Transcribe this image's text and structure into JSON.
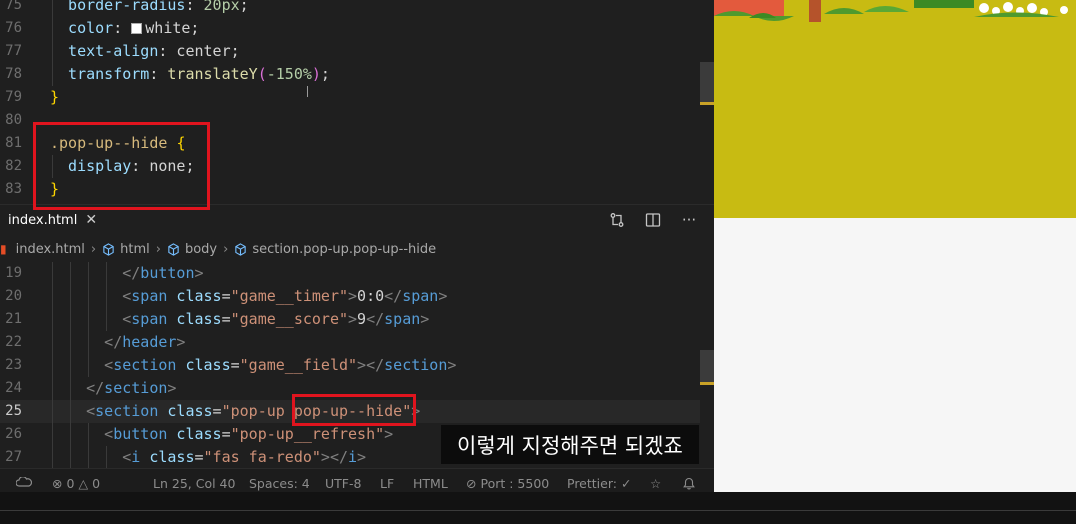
{
  "css_lines": [
    {
      "n": "75",
      "indent": 1,
      "tokens": [
        {
          "c": "prop",
          "t": "border-radius"
        },
        {
          "c": "punc",
          "t": ": "
        },
        {
          "c": "num",
          "t": "20px"
        },
        {
          "c": "punc",
          "t": ";"
        }
      ]
    },
    {
      "n": "76",
      "indent": 1,
      "tokens": [
        {
          "c": "prop",
          "t": "color"
        },
        {
          "c": "punc",
          "t": ": "
        },
        {
          "c": "swatch",
          "t": ""
        },
        {
          "c": "val",
          "t": "white"
        },
        {
          "c": "punc",
          "t": ";"
        }
      ]
    },
    {
      "n": "77",
      "indent": 1,
      "tokens": [
        {
          "c": "prop",
          "t": "text-align"
        },
        {
          "c": "punc",
          "t": ": "
        },
        {
          "c": "val",
          "t": "center"
        },
        {
          "c": "punc",
          "t": ";"
        }
      ]
    },
    {
      "n": "78",
      "indent": 1,
      "tokens": [
        {
          "c": "prop",
          "t": "transform"
        },
        {
          "c": "punc",
          "t": ": "
        },
        {
          "c": "fn",
          "t": "translateY"
        },
        {
          "c": "paren",
          "t": "("
        },
        {
          "c": "num",
          "t": "-150%"
        },
        {
          "c": "paren",
          "t": ")"
        },
        {
          "c": "punc",
          "t": ";"
        }
      ]
    },
    {
      "n": "79",
      "indent": 0,
      "tokens": [
        {
          "c": "brace",
          "t": "}"
        }
      ]
    },
    {
      "n": "80",
      "indent": 0,
      "tokens": []
    },
    {
      "n": "81",
      "indent": 0,
      "tokens": [
        {
          "c": "sel",
          "t": ".pop-up--hide"
        },
        {
          "c": "punc",
          "t": " "
        },
        {
          "c": "brace",
          "t": "{"
        }
      ]
    },
    {
      "n": "82",
      "indent": 1,
      "tokens": [
        {
          "c": "prop",
          "t": "display"
        },
        {
          "c": "punc",
          "t": ": "
        },
        {
          "c": "val",
          "t": "none"
        },
        {
          "c": "punc",
          "t": ";"
        }
      ]
    },
    {
      "n": "83",
      "indent": 0,
      "tokens": [
        {
          "c": "brace",
          "t": "}"
        }
      ]
    }
  ],
  "html_lines": [
    {
      "n": "19",
      "indent": 4,
      "tokens": [
        {
          "c": "br",
          "t": "</"
        },
        {
          "c": "tag",
          "t": "button"
        },
        {
          "c": "br",
          "t": ">"
        }
      ]
    },
    {
      "n": "20",
      "indent": 4,
      "tokens": [
        {
          "c": "br",
          "t": "<"
        },
        {
          "c": "tag",
          "t": "span"
        },
        {
          "c": "txt",
          "t": " "
        },
        {
          "c": "attr",
          "t": "class"
        },
        {
          "c": "txt",
          "t": "="
        },
        {
          "c": "str",
          "t": "\"game__timer\""
        },
        {
          "c": "br",
          "t": ">"
        },
        {
          "c": "txt",
          "t": "0:0"
        },
        {
          "c": "br",
          "t": "</"
        },
        {
          "c": "tag",
          "t": "span"
        },
        {
          "c": "br",
          "t": ">"
        }
      ]
    },
    {
      "n": "21",
      "indent": 4,
      "tokens": [
        {
          "c": "br",
          "t": "<"
        },
        {
          "c": "tag",
          "t": "span"
        },
        {
          "c": "txt",
          "t": " "
        },
        {
          "c": "attr",
          "t": "class"
        },
        {
          "c": "txt",
          "t": "="
        },
        {
          "c": "str",
          "t": "\"game__score\""
        },
        {
          "c": "br",
          "t": ">"
        },
        {
          "c": "txt",
          "t": "9"
        },
        {
          "c": "br",
          "t": "</"
        },
        {
          "c": "tag",
          "t": "span"
        },
        {
          "c": "br",
          "t": ">"
        }
      ]
    },
    {
      "n": "22",
      "indent": 3,
      "tokens": [
        {
          "c": "br",
          "t": "</"
        },
        {
          "c": "tag",
          "t": "header"
        },
        {
          "c": "br",
          "t": ">"
        }
      ]
    },
    {
      "n": "23",
      "indent": 3,
      "tokens": [
        {
          "c": "br",
          "t": "<"
        },
        {
          "c": "tag",
          "t": "section"
        },
        {
          "c": "txt",
          "t": " "
        },
        {
          "c": "attr",
          "t": "class"
        },
        {
          "c": "txt",
          "t": "="
        },
        {
          "c": "str",
          "t": "\"game__field\""
        },
        {
          "c": "br",
          "t": "></"
        },
        {
          "c": "tag",
          "t": "section"
        },
        {
          "c": "br",
          "t": ">"
        }
      ]
    },
    {
      "n": "24",
      "indent": 2,
      "tokens": [
        {
          "c": "br",
          "t": "</"
        },
        {
          "c": "tag",
          "t": "section"
        },
        {
          "c": "br",
          "t": ">"
        }
      ]
    },
    {
      "n": "25",
      "indent": 2,
      "current": true,
      "tokens": [
        {
          "c": "br",
          "t": "<"
        },
        {
          "c": "tag",
          "t": "section"
        },
        {
          "c": "txt",
          "t": " "
        },
        {
          "c": "attr",
          "t": "class"
        },
        {
          "c": "txt",
          "t": "="
        },
        {
          "c": "str",
          "t": "\"pop-up pop-up--hide"
        },
        {
          "c": "str",
          "t": "\""
        },
        {
          "c": "br",
          "t": ">"
        }
      ]
    },
    {
      "n": "26",
      "indent": 3,
      "tokens": [
        {
          "c": "br",
          "t": "<"
        },
        {
          "c": "tag",
          "t": "button"
        },
        {
          "c": "txt",
          "t": " "
        },
        {
          "c": "attr",
          "t": "class"
        },
        {
          "c": "txt",
          "t": "="
        },
        {
          "c": "str",
          "t": "\"pop-up__refresh\""
        },
        {
          "c": "br",
          "t": ">"
        }
      ]
    },
    {
      "n": "27",
      "indent": 4,
      "tokens": [
        {
          "c": "br",
          "t": "<"
        },
        {
          "c": "tag",
          "t": "i"
        },
        {
          "c": "txt",
          "t": " "
        },
        {
          "c": "attr",
          "t": "class"
        },
        {
          "c": "txt",
          "t": "="
        },
        {
          "c": "str",
          "t": "\"fas fa-redo\""
        },
        {
          "c": "br",
          "t": "></"
        },
        {
          "c": "tag",
          "t": "i"
        },
        {
          "c": "br",
          "t": ">"
        }
      ]
    }
  ],
  "tab": {
    "label": "index.html",
    "close": "✕"
  },
  "tab_actions": {
    "compare_icon": "git-compare-icon",
    "split_icon": "split-editor-icon",
    "more": "···"
  },
  "breadcrumb": {
    "file": "index.html",
    "html": "html",
    "body": "body",
    "section": "section.pop-up.pop-up--hide",
    "sep": "›"
  },
  "status": {
    "errors": "0",
    "warnings": "0",
    "position": "Ln 25, Col 40",
    "spaces": "Spaces: 4",
    "encoding": "UTF-8",
    "eol": "LF",
    "language": "HTML",
    "port": "Port : 5500",
    "prettier": "Prettier: ✓"
  },
  "subtitle": "이렇게 지정해주면 되겠죠",
  "colors": {
    "field": "#c8bb12",
    "highlight_box": "#e0141e",
    "editor_bg": "#1f1f1f"
  }
}
